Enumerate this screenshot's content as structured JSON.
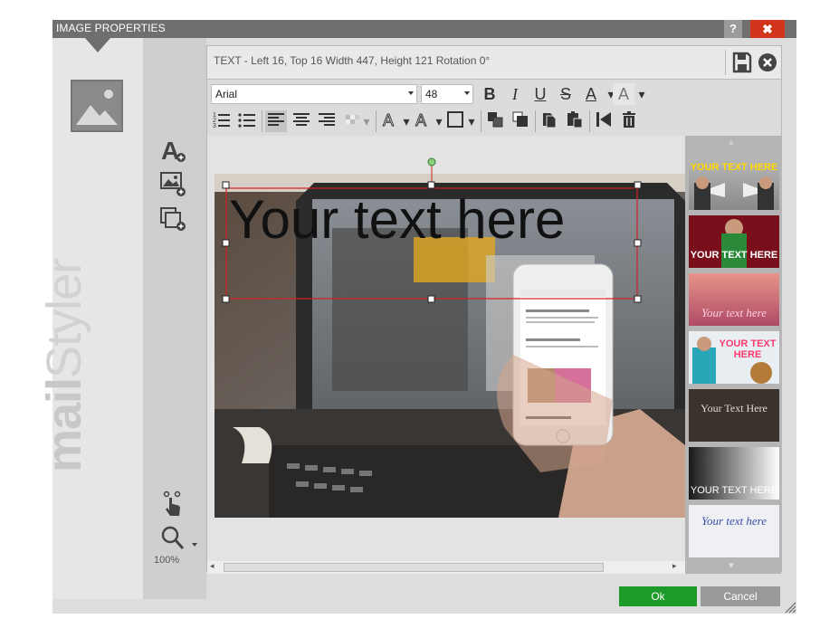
{
  "window": {
    "title": "IMAGE PROPERTIES",
    "help_label": "?",
    "close_label": "✖"
  },
  "brand": {
    "bold": "mail",
    "light": "Styler"
  },
  "tools": {
    "zoom_level": "100%"
  },
  "editor": {
    "status": "TEXT - Left 16, Top 16   Width  447, Height  121   Rotation 0°",
    "font_family": "Arial",
    "font_size": "48"
  },
  "toolbar": {
    "bold": "B",
    "italic": "I",
    "underline": "U",
    "strike": "S",
    "font_color": "A",
    "highlight": "A"
  },
  "canvas": {
    "text_layer": "Your text here"
  },
  "templates": [
    {
      "text": "YOUR TEXT HERE",
      "color": "#ffd800"
    },
    {
      "text": "YOUR TEXT HERE",
      "color": "#ffffff"
    },
    {
      "text": "Your text here",
      "color": "#ffd1e0"
    },
    {
      "text": "YOUR TEXT HERE",
      "color": "#ff3b6e"
    },
    {
      "text": "Your Text Here",
      "color": "#dddddd"
    },
    {
      "text": "YOUR TEXT HERE",
      "color": "#ffffff"
    },
    {
      "text": "Your text here",
      "color": "#3a4fa8"
    }
  ],
  "footer": {
    "ok_label": "Ok",
    "cancel_label": "Cancel"
  },
  "colors": {
    "titlebar": "#6f6f6f",
    "close": "#d3351c",
    "ok": "#1c9a2a",
    "cancel": "#9a9a9a",
    "selection": "#d32020"
  }
}
